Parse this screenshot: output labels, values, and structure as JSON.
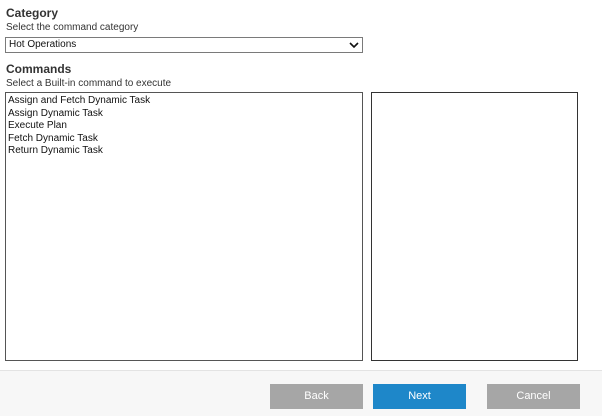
{
  "category": {
    "title": "Category",
    "description": "Select the command category",
    "selected_value": "Hot Operations"
  },
  "commands": {
    "title": "Commands",
    "description": "Select a Built-in command to execute",
    "items": [
      "Assign and Fetch Dynamic Task",
      "Assign Dynamic Task",
      "Execute Plan",
      "Fetch Dynamic Task",
      "Return Dynamic Task"
    ]
  },
  "icons": {
    "dropdown": "chevron-down-icon"
  },
  "footer": {
    "back_label": "Back",
    "next_label": "Next",
    "cancel_label": "Cancel"
  },
  "colors": {
    "next_button": "#1e87c9",
    "secondary_button": "#a6a6a6"
  }
}
